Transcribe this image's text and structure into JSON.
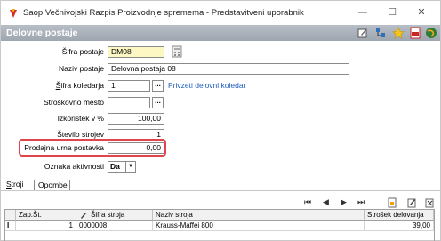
{
  "window": {
    "title": "Saop  Večnivojski Razpis Proizvodnje spremema - Predstavitveni uporabnik",
    "minimize": "—",
    "maximize": "☐",
    "close": "✕"
  },
  "header": {
    "title": "Delovne postaje"
  },
  "form": {
    "sifra_postaje_label": "Šifra postaje",
    "sifra_postaje_value": "DM08",
    "naziv_postaje_label": "Naziv postaje",
    "naziv_postaje_value": "Delovna postaja 08",
    "sifra_koledarja_label": "Šifra koledarja",
    "sifra_koledarja_value": "1",
    "privzeti_link": "Privzeti delovni koledar",
    "strokovno_mesto_label": "Stroškovno mesto",
    "strokovno_mesto_value": "",
    "izkoristek_label": "Izkoristek v %",
    "izkoristek_value": "100,00",
    "stevilo_strojev_label": "Število strojev",
    "stevilo_strojev_value": "1",
    "prodajna_label": "Prodajna urna postavka",
    "prodajna_value": "0,00",
    "oznaka_label": "Oznaka aktivnosti",
    "oznaka_value": "Da",
    "dots": "..."
  },
  "tabs": [
    {
      "label": "Stroji"
    },
    {
      "label": "Opombe"
    }
  ],
  "grid": {
    "columns": [
      "Zap.Št.",
      "Šifra stroja",
      "Naziv stroja",
      "Strošek delovanja"
    ],
    "rows": [
      {
        "marker": "I",
        "zap": "1",
        "sifra": "0000008",
        "naziv": "Krauss-Maffei 800",
        "strosek": "39,00"
      }
    ]
  },
  "toolbar": {
    "first": "⏮",
    "prev": "◀",
    "next": "▶",
    "last": "⏭"
  },
  "colors": {
    "highlight": "#e0454f",
    "header": "#a7afb8",
    "link": "#1f5fbf",
    "yellow": "#fdf7c4"
  }
}
